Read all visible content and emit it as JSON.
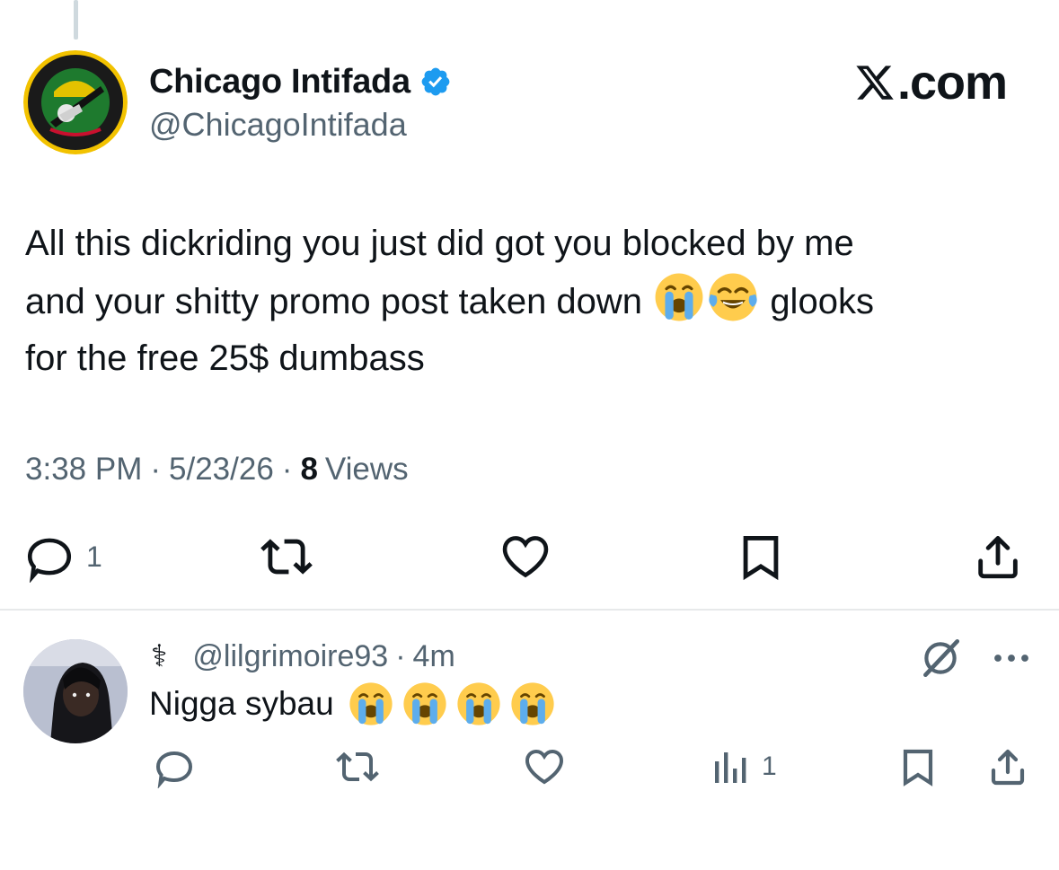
{
  "watermark": {
    "brand_text": ".com",
    "brand_icon": "x-logo-icon"
  },
  "main_tweet": {
    "display_name": "Chicago Intifada",
    "verified": true,
    "verified_color": "#1d9bf0",
    "handle": "@ChicagoIntifada",
    "text_line1": "All this dickriding you just did got you blocked by me",
    "text_line2a": "and your shitty promo post taken down",
    "text_line2b": "glooks",
    "text_line3": "for the free 25$ dumbass",
    "emojis": [
      "loudly-crying-face",
      "face-with-tears-of-joy"
    ],
    "time": "3:38 PM",
    "date": "5/23/26",
    "views_count": "8",
    "views_label": "Views",
    "actions": {
      "reply_count": "1",
      "icons": [
        "reply-icon",
        "retweet-icon",
        "like-icon",
        "bookmark-icon",
        "share-icon"
      ]
    }
  },
  "reply": {
    "name_glyph": "⚕",
    "handle": "@lilgrimoire93",
    "time_ago": "4m",
    "text": "Nigga sybau",
    "emojis": [
      "loudly-crying-face",
      "loudly-crying-face",
      "loudly-crying-face",
      "loudly-crying-face"
    ],
    "actions": {
      "views_count": "1",
      "icons": [
        "reply-icon",
        "retweet-icon",
        "like-icon",
        "views-icon",
        "bookmark-icon",
        "share-icon"
      ]
    }
  },
  "colors": {
    "text_primary": "#0f1419",
    "text_secondary": "#536471",
    "divider": "#e7e9ea",
    "emoji_yellow": "#ffcc4d",
    "tear_blue": "#5dadec"
  }
}
